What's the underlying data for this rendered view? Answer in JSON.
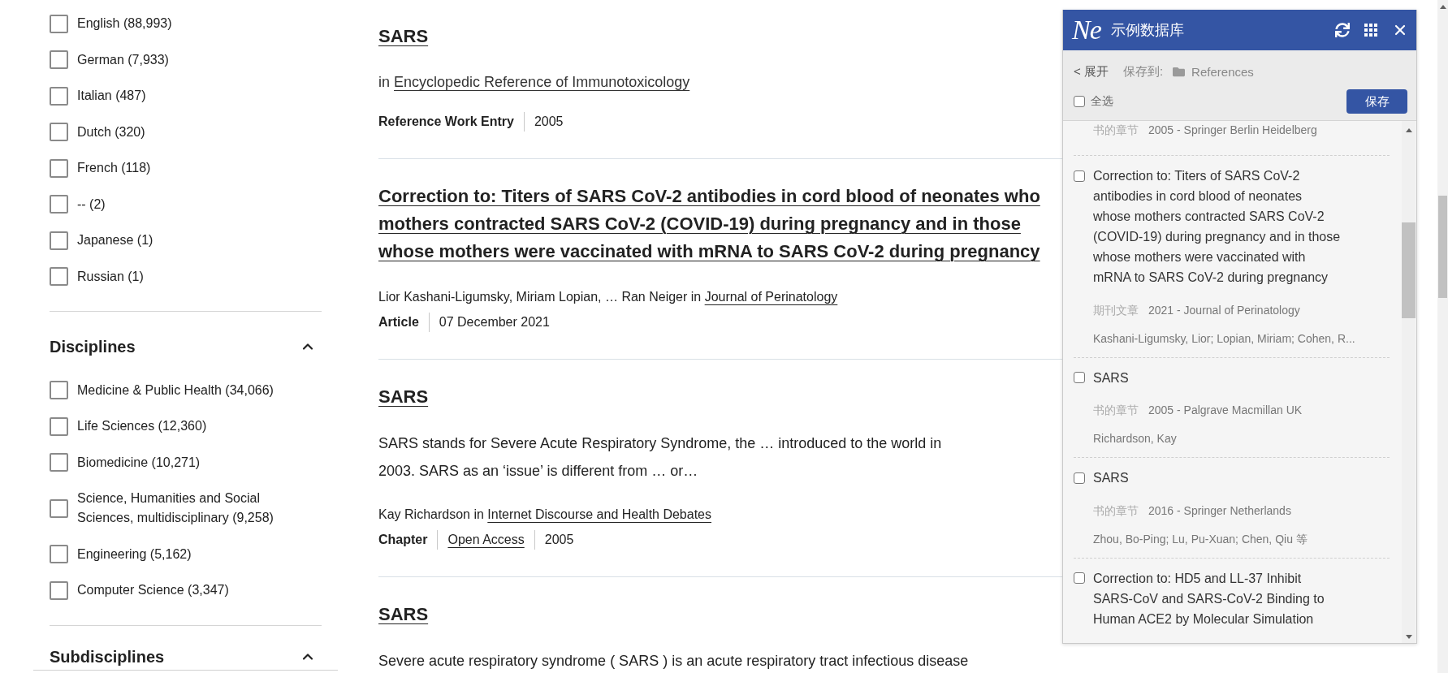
{
  "facets": {
    "options": [
      {
        "label": "English (88,993)",
        "checked": false
      },
      {
        "label": "German (7,933)",
        "checked": false
      },
      {
        "label": "Italian (487)",
        "checked": false
      },
      {
        "label": "Dutch (320)",
        "checked": false
      },
      {
        "label": "French (118)",
        "checked": false
      },
      {
        "label": "-- (2)",
        "checked": false
      },
      {
        "label": "Japanese (1)",
        "checked": false
      },
      {
        "label": "Russian (1)",
        "checked": false
      }
    ]
  },
  "disciplines": {
    "title": "Disciplines",
    "expanded": true,
    "options": [
      {
        "label": "Medicine & Public Health (34,066)",
        "checked": false
      },
      {
        "label": "Life Sciences (12,360)",
        "checked": false
      },
      {
        "label": "Biomedicine (10,271)",
        "checked": false
      },
      {
        "label": "Science, Humanities and Social Sciences, multidisciplinary (9,258)",
        "checked": false
      },
      {
        "label": "Engineering (5,162)",
        "checked": false
      },
      {
        "label": "Computer Science (3,347)",
        "checked": false
      }
    ]
  },
  "subdisciplines": {
    "title": "Subdisciplines",
    "expanded": true
  },
  "results": [
    {
      "title": "SARS",
      "source": {
        "text": "in",
        "link": "Encyclopedic Reference of Immunotoxicology"
      },
      "meta": [
        {
          "kind": "type",
          "text": "Reference Work Entry"
        },
        {
          "kind": "plain",
          "text": "2005"
        }
      ]
    },
    {
      "title": "Correction to: Titers of SARS CoV-2 antibodies in cord blood of neonates who\nmothers contracted SARS CoV-2 (COVID-19) during pregnancy and in those\nwhose mothers were vaccinated with mRNA to SARS CoV-2 during pregnancy",
      "byline": {
        "text": "Lior Kashani-Ligumsky, Miriam Lopian, … Ran Neiger in",
        "link": "Journal of Perinatology"
      },
      "meta": [
        {
          "kind": "type",
          "text": "Article"
        },
        {
          "kind": "plain",
          "text": "07 December 2021"
        }
      ]
    },
    {
      "title": "SARS",
      "snippet": "SARS stands for Severe Acute Respiratory Syndrome, the … introduced to the world in\n2003. SARS as an ‘issue’ is different from … or…",
      "byline": {
        "text": "Kay Richardson in",
        "link": "Internet Discourse and Health Debates"
      },
      "meta": [
        {
          "kind": "type",
          "text": "Chapter"
        },
        {
          "kind": "link",
          "text": "Open Access"
        },
        {
          "kind": "plain",
          "text": "2005"
        }
      ]
    },
    {
      "title": "SARS",
      "snippet": "Severe acute respiratory syndrome ( SARS ) is an acute respiratory tract infectious disease"
    }
  ],
  "panel": {
    "logo": "Ne",
    "title": "示例数据库",
    "expand": "< 展开",
    "save_to_label": "保存到:",
    "folder": "References",
    "select_all": {
      "label": "全选",
      "checked": false
    },
    "save_button": "保存",
    "items": [
      {
        "meta_type": "书的章节",
        "meta": "2005 - Springer Berlin Heidelberg"
      },
      {
        "checked": false,
        "title": "Correction to: Titers of SARS CoV-2\nantibodies in cord blood of neonates\nwhose mothers contracted SARS CoV-2\n(COVID-19) during pregnancy and in those\nwhose mothers were vaccinated with\nmRNA to SARS CoV-2 during pregnancy",
        "meta_type": "期刊文章",
        "meta": "2021 - Journal of Perinatology",
        "authors": "Kashani-Ligumsky, Lior; Lopian, Miriam; Cohen, R..."
      },
      {
        "checked": false,
        "title": "SARS",
        "meta_type": "书的章节",
        "meta": "2005 - Palgrave Macmillan UK",
        "authors": "Richardson, Kay"
      },
      {
        "checked": false,
        "title": "SARS",
        "meta_type": "书的章节",
        "meta": "2016 - Springer Netherlands",
        "authors": "Zhou, Bo-Ping; Lu, Pu-Xuan; Chen, Qiu 等"
      },
      {
        "checked": false,
        "title": "Correction to: HD5 and LL-37 Inhibit\nSARS-CoV and SARS-CoV-2 Binding to\nHuman ACE2 by Molecular Simulation"
      }
    ]
  }
}
